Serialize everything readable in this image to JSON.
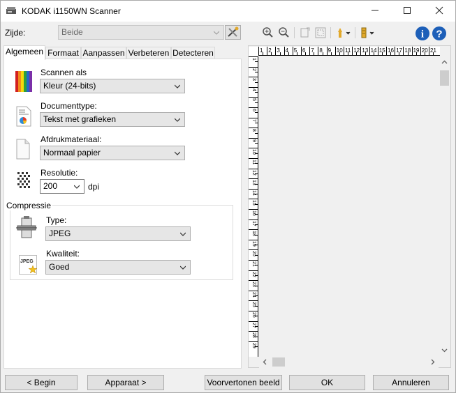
{
  "window": {
    "title": "KODAK i1150WN Scanner",
    "minimize": "—",
    "maximize": "☐",
    "close": "✕"
  },
  "toolbar": {
    "side_label": "Zijde:",
    "side_value": "Beide",
    "icons": [
      "settings-shortcut-icon",
      "zoom-in-icon",
      "zoom-out-icon",
      "rotate-icon",
      "fit-icon",
      "device-icon",
      "preview-area-icon",
      "info-icon",
      "help-icon"
    ]
  },
  "tabs": [
    "Algemeen",
    "Formaat",
    "Aanpassen",
    "Verbeteren",
    "Detecteren"
  ],
  "general": {
    "scan_as_label": "Scannen als",
    "scan_as_value": "Kleur (24-bits)",
    "doctype_label": "Documenttype:",
    "doctype_value": "Tekst met grafieken",
    "media_label": "Afdrukmateriaal:",
    "media_value": "Normaal papier",
    "resolution_label": "Resolutie:",
    "resolution_value": "200",
    "resolution_unit": "dpi"
  },
  "compression": {
    "group_label": "Compressie",
    "type_label": "Type:",
    "type_value": "JPEG",
    "quality_label": "Kwaliteit:",
    "quality_value": "Goed",
    "jpeg_icon_text": "JPEG"
  },
  "ruler": {
    "h_numbers": [
      "1",
      "2",
      "3",
      "4",
      "5",
      "6",
      "7",
      "8",
      "9",
      "10",
      "11",
      "12",
      "13",
      "14",
      "15",
      "16",
      "17",
      "18",
      "19",
      "20",
      "21"
    ],
    "v_numbers": [
      "1",
      "2",
      "3",
      "4",
      "5",
      "6",
      "7",
      "8",
      "9",
      "10",
      "11",
      "12",
      "13",
      "14",
      "15",
      "16",
      "17",
      "18",
      "19",
      "20",
      "21",
      "22",
      "23",
      "24",
      "25",
      "26",
      "27",
      "28",
      "29"
    ]
  },
  "buttons": {
    "back": "< Begin",
    "device": "Apparaat >",
    "preview": "Voorvertonen beeld",
    "ok": "OK",
    "cancel": "Annuleren"
  },
  "colors": {
    "info_blue": "#1d5fb8",
    "accent_gold": "#e2a92b"
  }
}
